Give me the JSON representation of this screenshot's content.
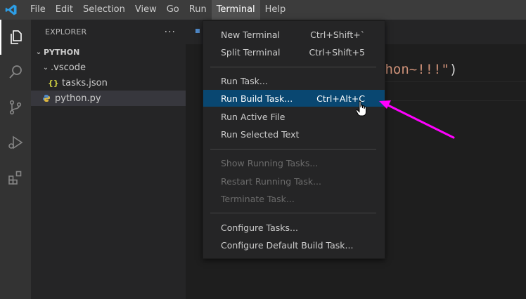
{
  "menubar": {
    "items": [
      "File",
      "Edit",
      "Selection",
      "View",
      "Go",
      "Run",
      "Terminal",
      "Help"
    ],
    "active_index": 6
  },
  "activitybar": {
    "icons": [
      "explorer-icon",
      "search-icon",
      "source-control-icon",
      "run-debug-icon",
      "extensions-icon"
    ]
  },
  "sidebar": {
    "title": "EXPLORER",
    "more": "···",
    "section": "PYTHON",
    "items": [
      {
        "label": ".vscode",
        "kind": "folder"
      },
      {
        "label": "tasks.json",
        "kind": "json",
        "icon_text": "{}"
      },
      {
        "label": "python.py",
        "kind": "python"
      }
    ]
  },
  "editor": {
    "code_fragment": "thon~!!!\"",
    "code_paren": ")"
  },
  "menu": {
    "groups": [
      [
        {
          "label": "New Terminal",
          "shortcut": "Ctrl+Shift+`"
        },
        {
          "label": "Split Terminal",
          "shortcut": "Ctrl+Shift+5"
        }
      ],
      [
        {
          "label": "Run Task...",
          "shortcut": ""
        },
        {
          "label": "Run Build Task...",
          "shortcut": "Ctrl+Alt+C"
        },
        {
          "label": "Run Active File",
          "shortcut": ""
        },
        {
          "label": "Run Selected Text",
          "shortcut": ""
        }
      ],
      [
        {
          "label": "Show Running Tasks...",
          "shortcut": ""
        },
        {
          "label": "Restart Running Task...",
          "shortcut": ""
        },
        {
          "label": "Terminate Task...",
          "shortcut": ""
        }
      ],
      [
        {
          "label": "Configure Tasks...",
          "shortcut": ""
        },
        {
          "label": "Configure Default Build Task...",
          "shortcut": ""
        }
      ]
    ]
  },
  "colors": {
    "menubar_bg": "#3c3c3c",
    "highlight": "#094771",
    "annotation_arrow": "#ff00ff",
    "string": "#ce9178"
  }
}
